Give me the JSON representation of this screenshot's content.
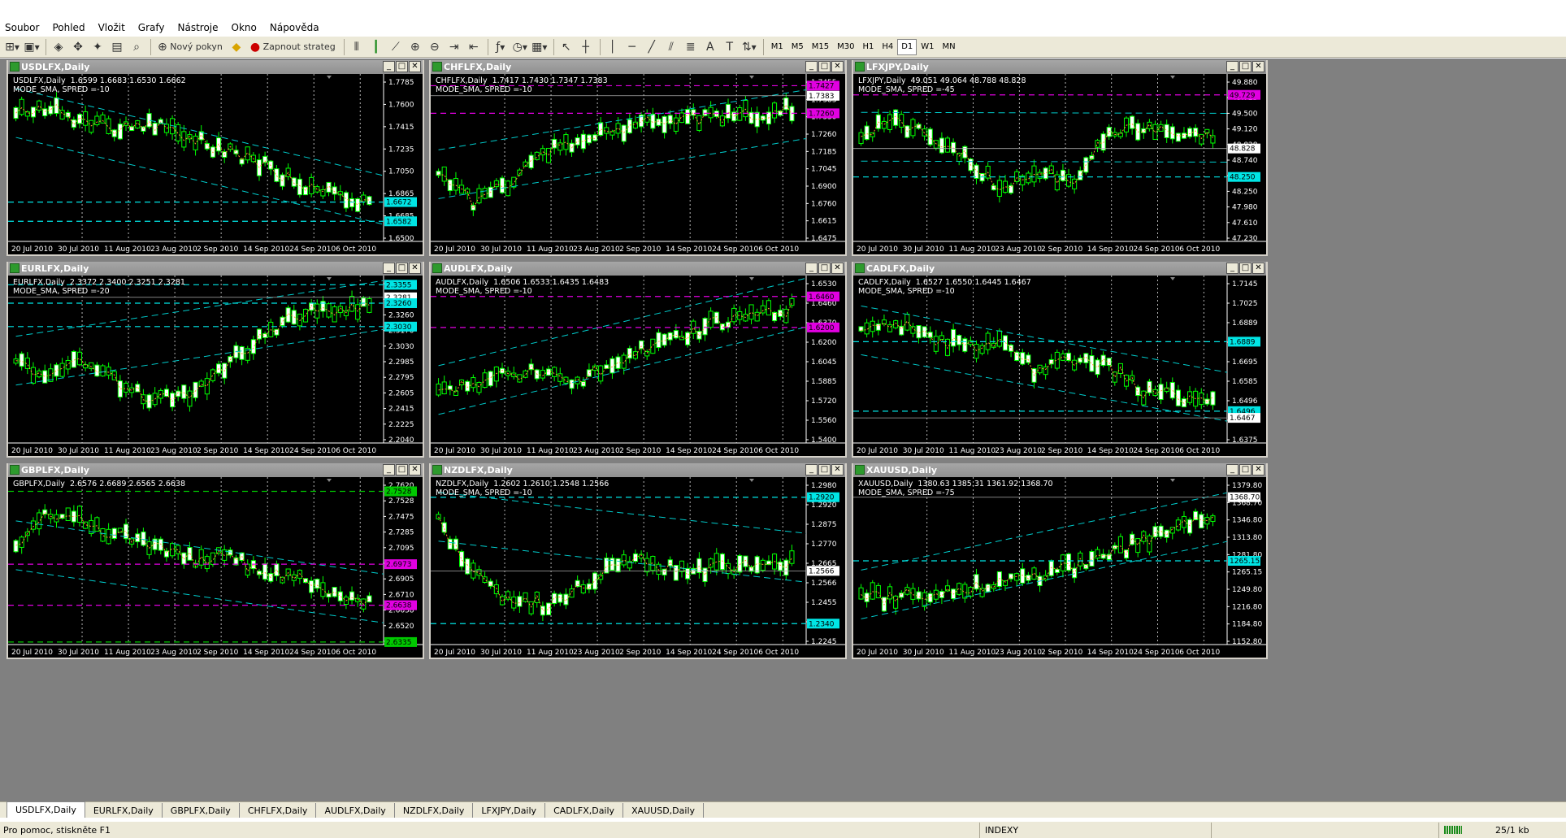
{
  "menu": [
    "Soubor",
    "Pohled",
    "Vložit",
    "Grafy",
    "Nástroje",
    "Okno",
    "Nápověda"
  ],
  "toolbar": {
    "new_order": "Nový pokyn",
    "autotrade": "Zapnout strateg",
    "timeframes": [
      "M1",
      "M5",
      "M15",
      "M30",
      "H1",
      "H4",
      "D1",
      "W1",
      "MN"
    ],
    "active_timeframe": "D1"
  },
  "x_dates": [
    "20 Jul 2010",
    "30 Jul 2010",
    "11 Aug 2010",
    "23 Aug 2010",
    "2 Sep 2010",
    "14 Sep 2010",
    "24 Sep 2010",
    "6 Oct 2010"
  ],
  "charts": [
    {
      "title": "USDLFX,Daily",
      "info1": "USDLFX,Daily  1.6599 1.6683 1.6530 1.6662",
      "info2": "MODE_SMA, SPRED =-10",
      "ticks": [
        "1.7785",
        "1.7600",
        "1.7415",
        "1.7235",
        "1.7050",
        "1.6865",
        "1.6685",
        "1.6500"
      ],
      "labels": [
        {
          "text": "1.6672",
          "bg": "#00e5e5",
          "fg": "#000",
          "y": 0.765
        },
        {
          "text": "1.6582",
          "bg": "#00e5e5",
          "fg": "#000",
          "y": 0.88
        }
      ]
    },
    {
      "title": "CHFLFX,Daily",
      "info1": "CHFLFX,Daily  1.7417 1.7430 1.7347 1.7383",
      "info2": "MODE_SMA, SPRED =-10",
      "ticks": [
        "1.7455",
        "1.7383",
        "1.7330",
        "1.7260",
        "1.7185",
        "1.7045",
        "1.6900",
        "1.6760",
        "1.6615",
        "1.6475"
      ],
      "labels": [
        {
          "text": "1.7427",
          "bg": "#e100e1",
          "fg": "#000",
          "y": 0.07
        },
        {
          "text": "1.7383",
          "bg": "#fff",
          "fg": "#000",
          "y": 0.13
        },
        {
          "text": "1.7260",
          "bg": "#e100e1",
          "fg": "#000",
          "y": 0.235
        }
      ]
    },
    {
      "title": "LFXJPY,Daily",
      "info1": "LFXJPY,Daily  49.051 49.064 48.788 48.828",
      "info2": "MODE_SMA, SPRED =-45",
      "ticks": [
        "49.880",
        "49.725",
        "49.500",
        "49.120",
        "48.828",
        "48.740",
        "48.360",
        "48.250",
        "47.980",
        "47.610",
        "47.230"
      ],
      "labels": [
        {
          "text": "49.729",
          "bg": "#e100e1",
          "fg": "#000",
          "y": 0.125
        },
        {
          "text": "48.828",
          "bg": "#fff",
          "fg": "#000",
          "y": 0.445
        },
        {
          "text": "48.250",
          "bg": "#00e5e5",
          "fg": "#000",
          "y": 0.615
        }
      ]
    },
    {
      "title": "EURLFX,Daily",
      "info1": "EURLFX,Daily  2.3372 2.3400 2.3251 2.3281",
      "info2": "MODE_SMA, SPRED =-20",
      "ticks": [
        "2.3355",
        "2.3281",
        "2.3260",
        "2.3170",
        "2.3030",
        "2.2985",
        "2.2795",
        "2.2605",
        "2.2415",
        "2.2225",
        "2.2040"
      ],
      "labels": [
        {
          "text": "2.3355",
          "bg": "#00e5e5",
          "fg": "#000",
          "y": 0.055
        },
        {
          "text": "2.3281",
          "bg": "#fff",
          "fg": "#000",
          "y": 0.13
        },
        {
          "text": "2.3260",
          "bg": "#00e5e5",
          "fg": "#000",
          "y": 0.165
        },
        {
          "text": "2.3030",
          "bg": "#00e5e5",
          "fg": "#000",
          "y": 0.305
        }
      ]
    },
    {
      "title": "AUDLFX,Daily",
      "info1": "AUDLFX,Daily  1.6506 1.6533 1.6435 1.6483",
      "info2": "MODE_SMA, SPRED =-10",
      "ticks": [
        "1.6530",
        "1.6460",
        "1.6370",
        "1.6200",
        "1.6045",
        "1.5885",
        "1.5720",
        "1.5560",
        "1.5400"
      ],
      "labels": [
        {
          "text": "1.6460",
          "bg": "#e100e1",
          "fg": "#000",
          "y": 0.125
        },
        {
          "text": "1.6200",
          "bg": "#e100e1",
          "fg": "#000",
          "y": 0.31
        }
      ]
    },
    {
      "title": "CADLFX,Daily",
      "info1": "CADLFX,Daily  1.6527 1.6550 1.6445 1.6467",
      "info2": "MODE_SMA, SPRED =-10",
      "ticks": [
        "1.7145",
        "1.7025",
        "1.6889",
        "1.6815",
        "1.6695",
        "1.6585",
        "1.6496",
        "1.6467",
        "1.6375"
      ],
      "labels": [
        {
          "text": "1.6889",
          "bg": "#00e5e5",
          "fg": "#000",
          "y": 0.395
        },
        {
          "text": "1.6496",
          "bg": "#00e5e5",
          "fg": "#000",
          "y": 0.81
        },
        {
          "text": "1.6467",
          "bg": "#fff",
          "fg": "#000",
          "y": 0.85
        }
      ]
    },
    {
      "title": "GBPLFX,Daily",
      "info1": "GBPLFX,Daily  2.6576 2.6689 2.6565 2.6638",
      "info2": "",
      "ticks": [
        "2.7620",
        "2.7528",
        "2.7475",
        "2.7285",
        "2.7095",
        "2.6973",
        "2.6905",
        "2.6710",
        "2.6638",
        "2.6520",
        "2.6335"
      ],
      "labels": [
        {
          "text": "2.7528",
          "bg": "#00c800",
          "fg": "#000",
          "y": 0.085
        },
        {
          "text": "2.6973",
          "bg": "#e100e1",
          "fg": "#000",
          "y": 0.52
        },
        {
          "text": "2.6638",
          "bg": "#e100e1",
          "fg": "#000",
          "y": 0.765
        },
        {
          "text": "2.6335",
          "bg": "#00c800",
          "fg": "#000",
          "y": 0.985
        }
      ]
    },
    {
      "title": "NZDLFX,Daily",
      "info1": "NZDLFX,Daily  1.2602 1.2610 1.2548 1.2566",
      "info2": "MODE_SMA, SPRED =-10",
      "ticks": [
        "1.2980",
        "1.2920",
        "1.2875",
        "1.2770",
        "1.2665",
        "1.2566",
        "1.2455",
        "1.2340",
        "1.2245"
      ],
      "labels": [
        {
          "text": "1.2920",
          "bg": "#00e5e5",
          "fg": "#000",
          "y": 0.12
        },
        {
          "text": "1.2566",
          "bg": "#fff",
          "fg": "#000",
          "y": 0.56
        },
        {
          "text": "1.2340",
          "bg": "#00e5e5",
          "fg": "#000",
          "y": 0.875
        }
      ]
    },
    {
      "title": "XAUUSD,Daily",
      "info1": "XAUUSD,Daily  1380.63 1385.31 1361.92 1368.70",
      "info2": "MODE_SMA, SPRED =-75",
      "ticks": [
        "1379.80",
        "1368.70",
        "1346.80",
        "1313.80",
        "1281.80",
        "1265.15",
        "1249.80",
        "1216.80",
        "1184.80",
        "1152.80"
      ],
      "labels": [
        {
          "text": "1368.70",
          "bg": "#fff",
          "fg": "#000",
          "y": 0.12
        },
        {
          "text": "1265.15",
          "bg": "#00e5e5",
          "fg": "#000",
          "y": 0.5
        }
      ]
    }
  ],
  "tabs": [
    "USDLFX,Daily",
    "EURLFX,Daily",
    "GBPLFX,Daily",
    "CHFLFX,Daily",
    "AUDLFX,Daily",
    "NZDLFX,Daily",
    "LFXJPY,Daily",
    "CADLFX,Daily",
    "XAUUSD,Daily"
  ],
  "active_tab": "USDLFX,Daily",
  "status": {
    "help": "Pro pomoc, stiskněte F1",
    "profile": "INDEXY",
    "traffic": "25/1 kb"
  }
}
